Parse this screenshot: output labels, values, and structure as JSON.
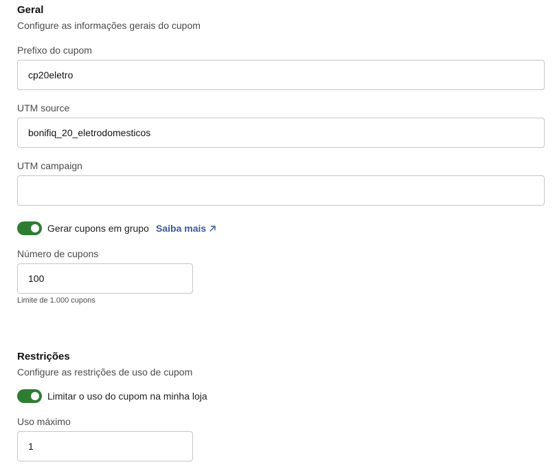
{
  "general": {
    "title": "Geral",
    "subtitle": "Configure as informações gerais do cupom",
    "coupon_prefix": {
      "label": "Prefixo do cupom",
      "value": "cp20eletro"
    },
    "utm_source": {
      "label": "UTM source",
      "value": "bonifiq_20_eletrodomesticos"
    },
    "utm_campaign": {
      "label": "UTM campaign",
      "value": ""
    },
    "group_toggle": {
      "label": "Gerar cupons em grupo",
      "enabled": true,
      "link_label": "Saiba mais"
    },
    "coupon_count": {
      "label": "Número de cupons",
      "value": "100",
      "helper": "Limite de 1.000 cupons"
    }
  },
  "restrictions": {
    "title": "Restrições",
    "subtitle": "Configure as restrições de uso de cupom",
    "limit_toggle": {
      "label": "Limitar o uso do cupom na minha loja",
      "enabled": true
    },
    "max_use": {
      "label": "Uso máximo",
      "value": "1"
    }
  },
  "colors": {
    "toggle_on": "#2e7d32",
    "link": "#3b5998",
    "input_border": "#c6c6c6"
  }
}
